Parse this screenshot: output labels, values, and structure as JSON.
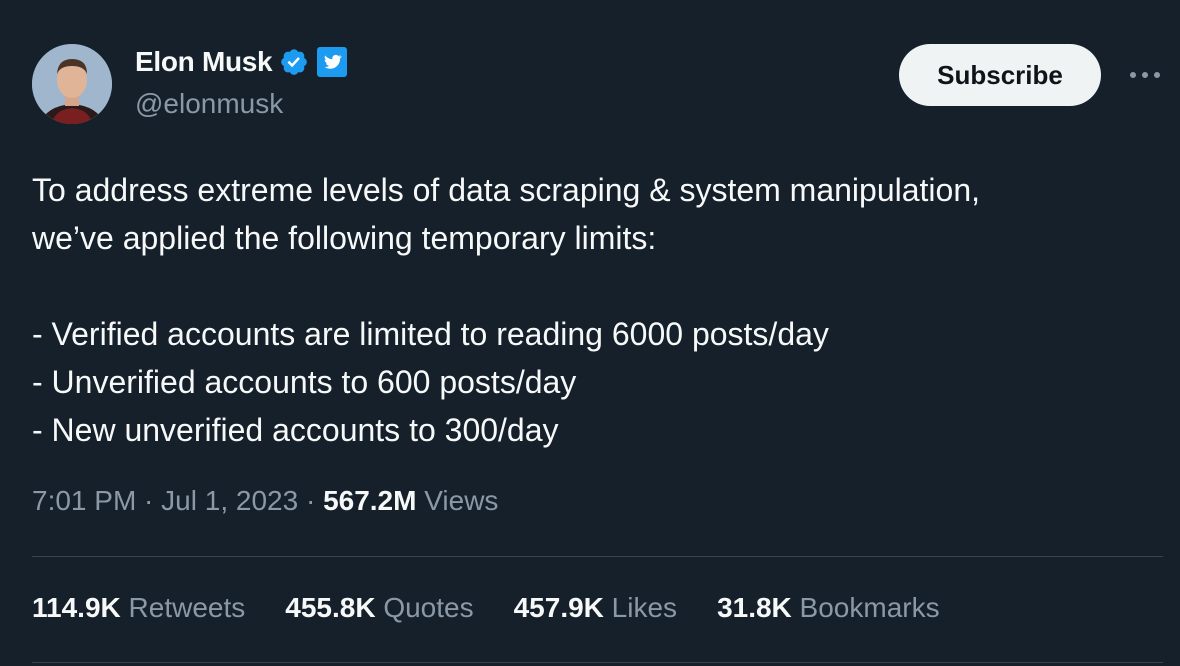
{
  "author": {
    "name": "Elon Musk",
    "handle": "@elonmusk",
    "verified_icon": "verified-badge-icon",
    "platform_icon": "twitter-bird-icon",
    "avatar_icon": "profile-avatar"
  },
  "actions": {
    "subscribe_label": "Subscribe",
    "more_icon": "more-options-icon"
  },
  "tweet": {
    "lines": [
      "To address extreme levels of data scraping & system manipulation,",
      "we’ve applied the following temporary limits:",
      "",
      "- Verified accounts are limited to reading 6000 posts/day",
      "- Unverified accounts to 600 posts/day",
      "- New unverified accounts to 300/day"
    ]
  },
  "meta": {
    "time": "7:01 PM",
    "sep1": " · ",
    "date": "Jul 1, 2023",
    "sep2": " · ",
    "views_count": "567.2M",
    "views_label": " Views"
  },
  "stats": {
    "retweets_count": "114.9K",
    "retweets_label": " Retweets",
    "quotes_count": "455.8K",
    "quotes_label": " Quotes",
    "likes_count": "457.9K",
    "likes_label": " Likes",
    "bookmarks_count": "31.8K",
    "bookmarks_label": " Bookmarks"
  },
  "colors": {
    "background": "#15202b",
    "text": "#f7f9f9",
    "muted": "#8b98a5",
    "verified_blue": "#1d9bf0",
    "divider": "#38444d"
  }
}
